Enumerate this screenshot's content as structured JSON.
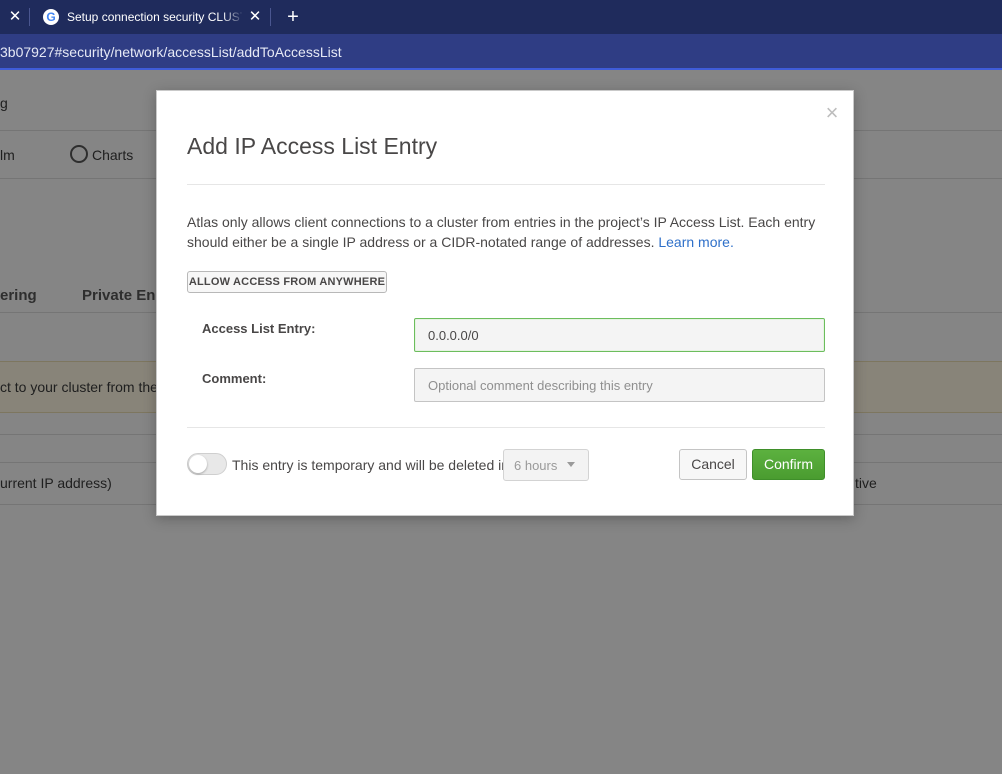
{
  "browser": {
    "tab_title": "Setup connection security CLUST",
    "favicon_letter": "G",
    "address": "3b07927#security/network/accessList/addToAccessList"
  },
  "background_page": {
    "breadcrumb_fragment": "g",
    "nav_fragment": "lm",
    "charts_label": "Charts",
    "tab_fragment_1": "ering",
    "tab_fragment_2": "Private En",
    "banner_fragment": "ct to your cluster from the f",
    "row_fragment": "urrent IP address)",
    "status_fragment": "tive"
  },
  "modal": {
    "title": "Add IP Access List Entry",
    "description": "Atlas only allows client connections to a cluster from entries in the project’s IP Access List. Each entry should either be a single IP address or a CIDR-notated range of addresses.",
    "learn_more": "Learn more.",
    "allow_anywhere_label": "ALLOW ACCESS FROM ANYWHERE",
    "entry_label": "Access List Entry:",
    "entry_value": "0.0.0.0/0",
    "comment_label": "Comment:",
    "comment_placeholder": "Optional comment describing this entry",
    "temporary_text": "This entry is temporary and will be deleted in",
    "hours_value": "6 hours",
    "cancel_label": "Cancel",
    "confirm_label": "Confirm"
  },
  "colors": {
    "tabbar": "#1f2b5c",
    "addressbar": "#2f3d84",
    "confirm_green": "#4a9c30",
    "focus_border": "#6cbd5d",
    "link": "#2f70c9"
  }
}
